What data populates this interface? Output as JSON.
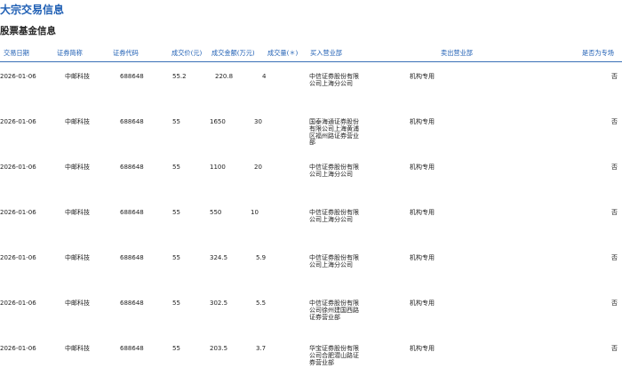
{
  "page_title": "大宗交易信息",
  "section_title": "股票基金信息",
  "columns": [
    "交易日期",
    "证券简称",
    "证券代码",
    "成交价(元)",
    "成交金额(万元)",
    "成交量(＊)",
    "买入营业部",
    "卖出营业部",
    "是否为专场"
  ],
  "rows": [
    {
      "date": "2026-01-06",
      "name": "中邮科技",
      "code": "688648",
      "price": "55.2",
      "amount": "220.8",
      "volume": "4",
      "buyer": "中信证券股份有限公司上海分公司",
      "seller": "机构专用",
      "special": "否"
    },
    {
      "date": "2026-01-06",
      "name": "中邮科技",
      "code": "688648",
      "price": "55",
      "amount": "1650",
      "volume": "30",
      "buyer": "国泰海通证券股份有限公司上海黄浦区福州路证券营业部",
      "seller": "机构专用",
      "special": "否"
    },
    {
      "date": "2026-01-06",
      "name": "中邮科技",
      "code": "688648",
      "price": "55",
      "amount": "1100",
      "volume": "20",
      "buyer": "中信证券股份有限公司上海分公司",
      "seller": "机构专用",
      "special": "否"
    },
    {
      "date": "2026-01-06",
      "name": "中邮科技",
      "code": "688648",
      "price": "55",
      "amount": "550",
      "volume": "10",
      "buyer": "中信证券股份有限公司上海分公司",
      "seller": "机构专用",
      "special": "否"
    },
    {
      "date": "2026-01-06",
      "name": "中邮科技",
      "code": "688648",
      "price": "55",
      "amount": "324.5",
      "volume": "5.9",
      "buyer": "中信证券股份有限公司上海分公司",
      "seller": "机构专用",
      "special": "否"
    },
    {
      "date": "2026-01-06",
      "name": "中邮科技",
      "code": "688648",
      "price": "55",
      "amount": "302.5",
      "volume": "5.5",
      "buyer": "中信证券股份有限公司徐州建国西路证券营业部",
      "seller": "机构专用",
      "special": "否"
    },
    {
      "date": "2026-01-06",
      "name": "中邮科技",
      "code": "688648",
      "price": "55",
      "amount": "203.5",
      "volume": "3.7",
      "buyer": "华宝证券股份有限公司合肥潜山路证券营业部",
      "seller": "机构专用",
      "special": "否"
    }
  ]
}
